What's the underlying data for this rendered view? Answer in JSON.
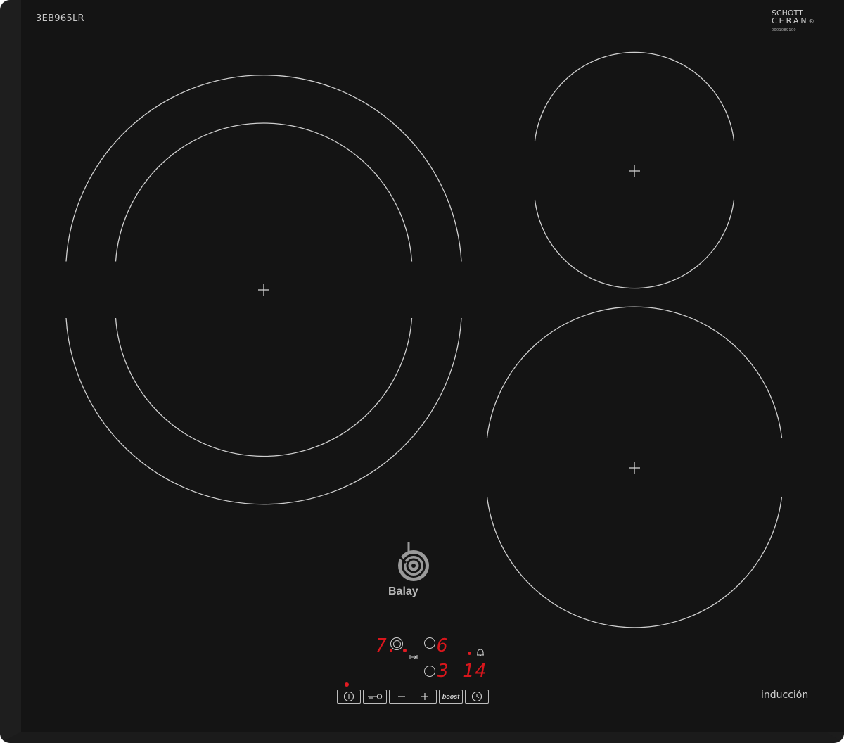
{
  "hob": {
    "model": "3EB965LR",
    "glass_brand": {
      "line1": "SCHOTT",
      "line2": "CERAN",
      "serial": "0001089100"
    },
    "brand": "Balay",
    "technology_label": "inducción"
  },
  "zones": [
    {
      "name": "front-left-dual",
      "type": "dual",
      "icon": "crosshair-icon"
    },
    {
      "name": "rear-right",
      "type": "single",
      "icon": "crosshair-icon"
    },
    {
      "name": "front-right",
      "type": "single",
      "icon": "crosshair-icon"
    }
  ],
  "display": {
    "zone_left_level": "7.",
    "zone_top_right_level": "6",
    "zone_bottom_right_level": "3",
    "timer_minutes": "14",
    "accent_color": "#d8161c"
  },
  "controls": {
    "power": {
      "icon": "power-icon"
    },
    "lock": {
      "icon": "key-icon"
    },
    "minus": {
      "icon": "minus-icon"
    },
    "plus": {
      "icon": "plus-icon"
    },
    "boost": {
      "label": "boost"
    },
    "timer": {
      "icon": "clock-icon"
    }
  }
}
